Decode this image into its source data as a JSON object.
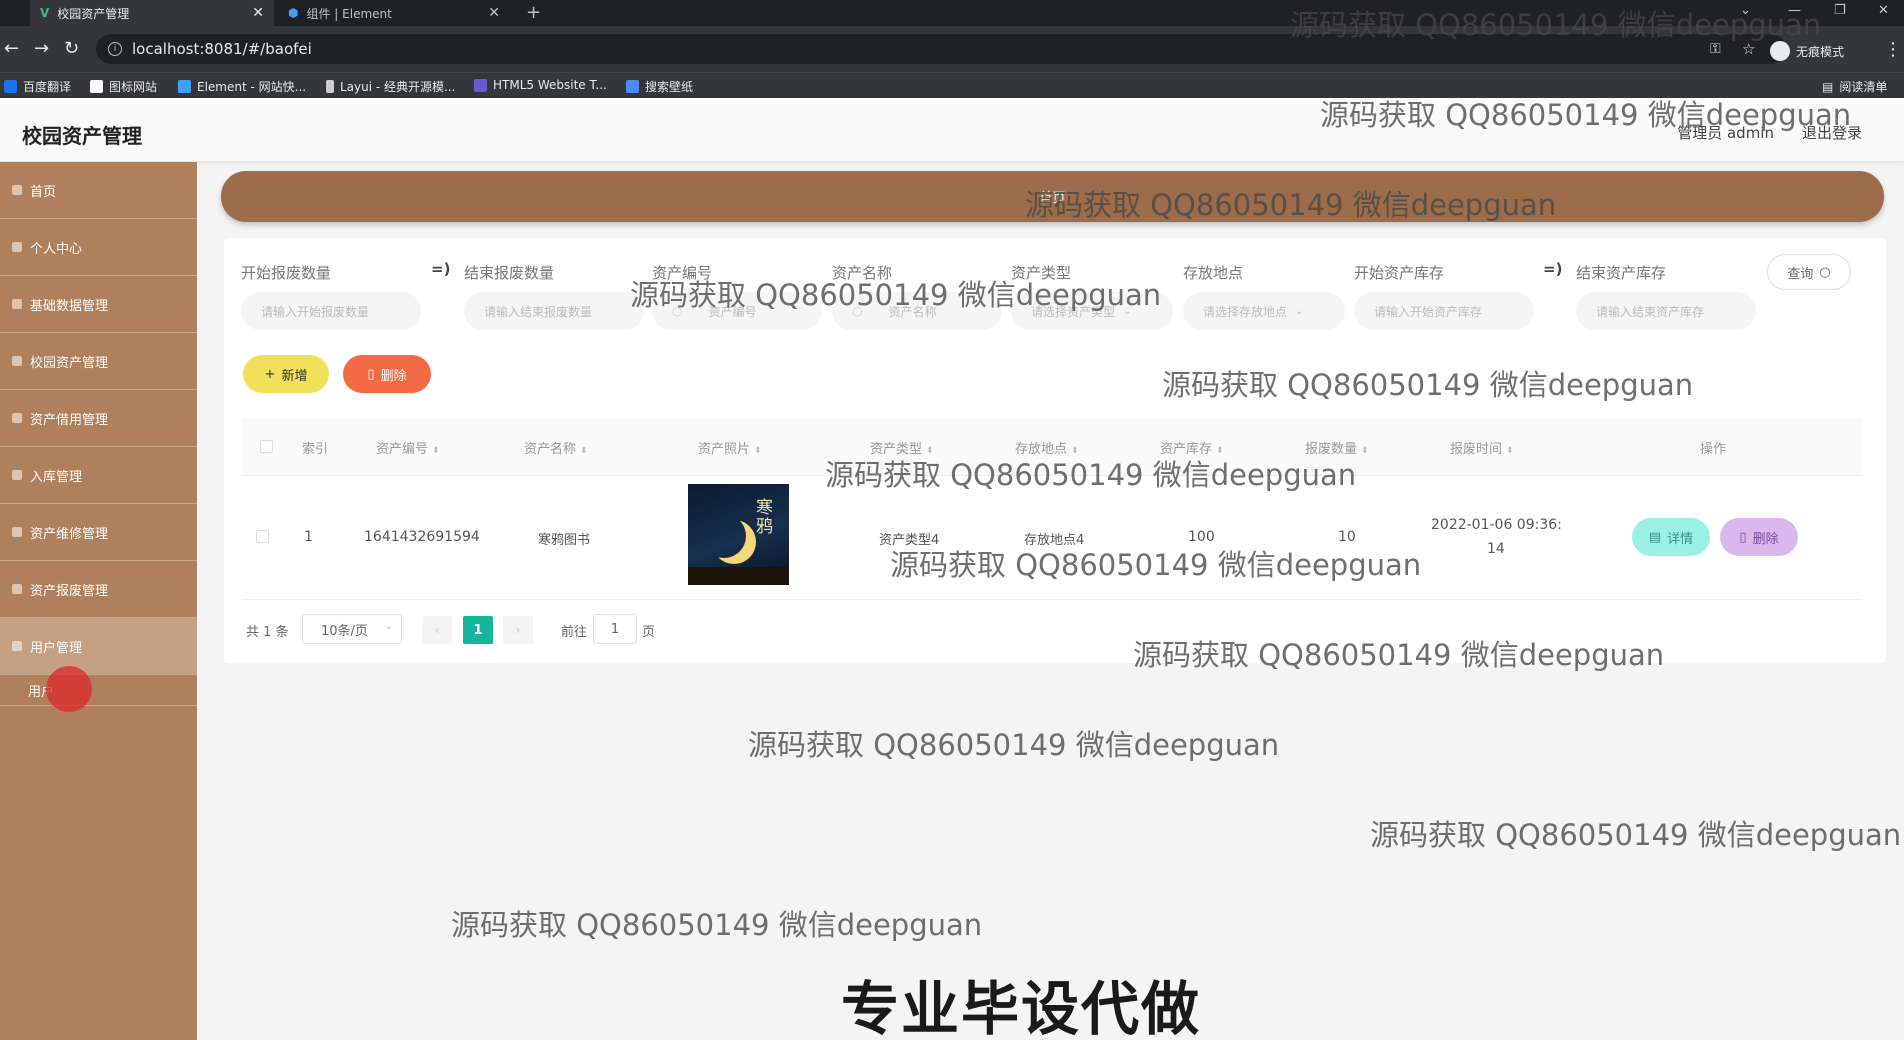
{
  "browser": {
    "tabs": [
      {
        "title": "校园资产管理",
        "icon": "V"
      },
      {
        "title": "组件 | Element"
      }
    ],
    "new_tab": "+",
    "url": "localhost:8081/#/baofei",
    "incognito_label": "无痕模式",
    "bookmarks": [
      "百度翻译",
      "图标网站",
      "Element - 网站快...",
      "Layui - 经典开源模...",
      "HTML5 Website T...",
      "搜索壁纸"
    ],
    "reading_list": "阅读清单"
  },
  "header": {
    "title": "校园资产管理",
    "admin_label": "管理员 admin",
    "logout": "退出登录"
  },
  "sidebar": {
    "items": [
      {
        "label": "首页"
      },
      {
        "label": "个人中心"
      },
      {
        "label": "基础数据管理"
      },
      {
        "label": "校园资产管理"
      },
      {
        "label": "资产借用管理"
      },
      {
        "label": "入库管理"
      },
      {
        "label": "资产维修管理"
      },
      {
        "label": "资产报废管理"
      },
      {
        "label": "用户管理"
      }
    ],
    "submenu_label": "用户"
  },
  "breadcrumb": {
    "home": "首页"
  },
  "search": {
    "fields": [
      {
        "label": "开始报废数量",
        "placeholder": "请输入开始报废数量"
      },
      {
        "label": "结束报废数量",
        "placeholder": "请输入结束报废数量"
      },
      {
        "label": "资产编号",
        "placeholder": "资产编号"
      },
      {
        "label": "资产名称",
        "placeholder": "资产名称"
      },
      {
        "label": "资产类型",
        "placeholder": "请选择资产类型"
      },
      {
        "label": "存放地点",
        "placeholder": "请选择存放地点"
      },
      {
        "label": "开始资产库存",
        "placeholder": "请输入开始资产库存"
      },
      {
        "label": "结束资产库存",
        "placeholder": "请输入结束资产库存"
      }
    ],
    "range_arrow": "=)",
    "query_button": "查询"
  },
  "actions": {
    "add": "新增",
    "delete": "删除"
  },
  "table": {
    "headers": [
      "索引",
      "资产编号",
      "资产名称",
      "资产照片",
      "资产类型",
      "存放地点",
      "资产库存",
      "报废数量",
      "报废时间",
      "操作"
    ],
    "rows": [
      {
        "index": "1",
        "code": "1641432691594",
        "name": "寒鸦图书",
        "photo_title": "寒鸦",
        "type": "资产类型4",
        "location": "存放地点4",
        "stock": "100",
        "scrap_count": "10",
        "scrap_time_line1": "2022-01-06 09:36:",
        "scrap_time_line2": "14",
        "detail_label": "详情",
        "delete_label": "删除"
      }
    ]
  },
  "pagination": {
    "total": "共 1 条",
    "page_size": "10条/页",
    "prev": "‹",
    "current": "1",
    "next": "›",
    "goto_label": "前往",
    "goto_value": "1",
    "page_suffix": "页"
  },
  "watermark_text": "源码获取 QQ86050149 微信deepguan",
  "caption": "专业毕设代做",
  "colors": {
    "sidebar": "#b07f5c",
    "breadcrumb_bar": "#9d6c4a",
    "add_button": "#f1e05a",
    "delete_button": "#f46a44",
    "detail_button": "#9bf0e6",
    "row_delete_button": "#d8b8ef",
    "pagination_active": "#17b59b"
  }
}
